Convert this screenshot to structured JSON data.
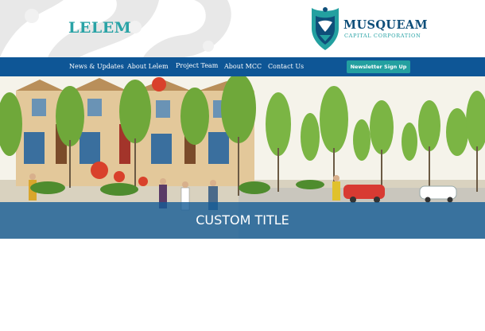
{
  "header": {
    "site_title": "LELEM",
    "brand": {
      "name": "MUSQUEAM",
      "subtitle": "CAPITAL CORPORATION",
      "logo_icon": "musqueam-shield-icon"
    }
  },
  "nav": {
    "items": [
      {
        "label": "News & Updates"
      },
      {
        "label": "About Lelem"
      },
      {
        "label": "Project Team"
      },
      {
        "label": "About MCC"
      },
      {
        "label": "Contact Us"
      }
    ],
    "cta_label": "Newsletter Sign Up"
  },
  "hero": {
    "title": "CUSTOM TITLE"
  },
  "colors": {
    "nav_bg": "#0e5696",
    "accent_teal": "#29a3a6",
    "brand_navy": "#0f4f7a",
    "cta_bg": "#23a0a0",
    "hero_band": "#155c96"
  }
}
